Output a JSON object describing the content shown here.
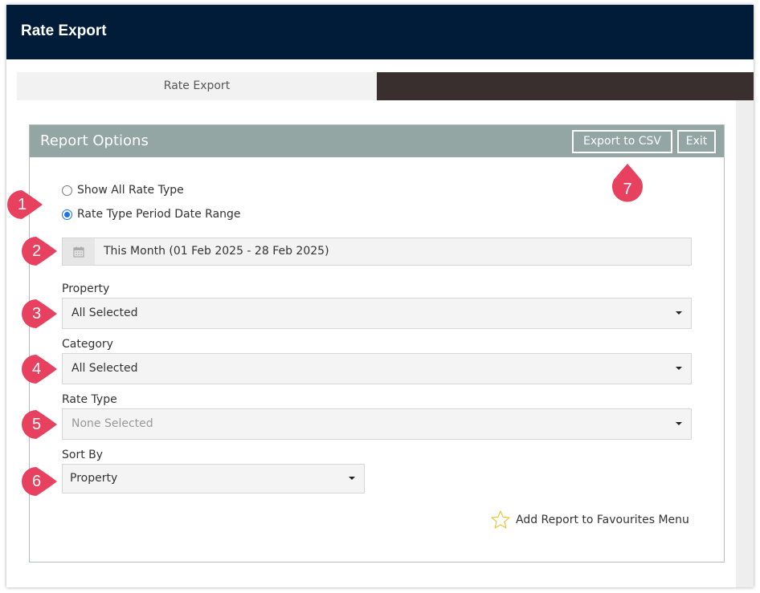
{
  "window": {
    "title": "Rate Export"
  },
  "tabs": [
    {
      "label": "Rate Export",
      "active": true
    }
  ],
  "report_options": {
    "title": "Report Options",
    "export_button": "Export to CSV",
    "exit_button": "Exit",
    "radios": [
      {
        "label": "Show All Rate Type",
        "checked": false
      },
      {
        "label": "Rate Type Period Date Range",
        "checked": true
      }
    ],
    "date_range": {
      "value": "This Month (01 Feb 2025 - 28 Feb 2025)",
      "icon": "calendar-icon"
    },
    "property": {
      "label": "Property",
      "value": "All Selected"
    },
    "category": {
      "label": "Category",
      "value": "All Selected"
    },
    "rate_type": {
      "label": "Rate Type",
      "value": "None Selected"
    },
    "sort_by": {
      "label": "Sort By",
      "value": "Property"
    },
    "favourites": {
      "label": "Add Report to Favourites Menu",
      "icon": "star-icon"
    }
  },
  "annotations": [
    "1",
    "2",
    "3",
    "4",
    "5",
    "6",
    "7"
  ],
  "colors": {
    "titlebar": "#001c38",
    "panel_header": "#93a6a4",
    "marker": "#e8415f",
    "radio_checked": "#1a73e8",
    "tab_inactive_area": "#3a2f2f"
  }
}
